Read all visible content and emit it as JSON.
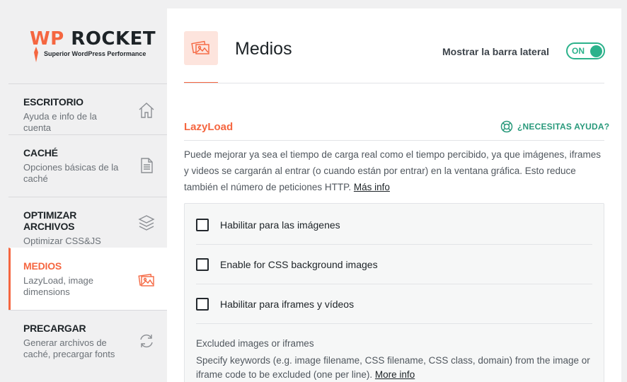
{
  "brand": {
    "name_wp": "WP",
    "name_rest": "ROCKET",
    "tagline": "Superior WordPress Performance",
    "accent": "#f56640",
    "green": "#2bb28b"
  },
  "sidebar": {
    "items": [
      {
        "title": "ESCRITORIO",
        "desc": "Ayuda e info de la cuenta",
        "icon": "home-icon"
      },
      {
        "title": "CACHÉ",
        "desc": "Opciones básicas de la caché",
        "icon": "document-icon"
      },
      {
        "title": "OPTIMIZAR ARCHIVOS",
        "desc": "Optimizar CSS&JS",
        "icon": "layers-icon"
      },
      {
        "title": "MEDIOS",
        "desc": "LazyLoad, image dimensions",
        "icon": "images-icon",
        "active": true
      },
      {
        "title": "PRECARGAR",
        "desc": "Generar archivos de caché, precargar fonts",
        "icon": "refresh-icon"
      }
    ]
  },
  "header": {
    "title": "Medios",
    "sidebar_toggle_label": "Mostrar la barra lateral",
    "toggle_state": "ON"
  },
  "section": {
    "title": "LazyLoad",
    "help_label": "¿NECESITAS AYUDA?",
    "description": "Puede mejorar ya sea el tiempo de carga real como el tiempo percibido, ya que imágenes, iframes y videos se cargarán al entrar (o cuando están por entrar) en la ventana gráfica. Esto reduce también el número de peticiones HTTP.",
    "more_info": "Más info"
  },
  "options": [
    {
      "label": "Habilitar para las imágenes",
      "checked": false
    },
    {
      "label": "Enable for CSS background images",
      "checked": false
    },
    {
      "label": "Habilitar para iframes y vídeos",
      "checked": false
    }
  ],
  "excluded": {
    "title": "Excluded images or iframes",
    "description": "Specify keywords (e.g. image filename, CSS filename, CSS class, domain) from the image or iframe code to be excluded (one per line).",
    "more_info": "More info"
  }
}
